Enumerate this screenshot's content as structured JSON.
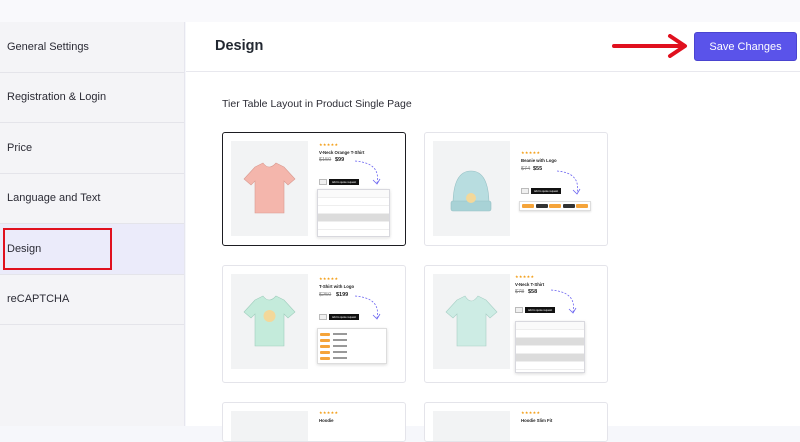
{
  "sidebar": {
    "items": [
      {
        "label": "General Settings"
      },
      {
        "label": "Registration & Login"
      },
      {
        "label": "Price"
      },
      {
        "label": "Language and Text"
      },
      {
        "label": "Design",
        "active": true
      },
      {
        "label": "reCAPTCHA"
      }
    ]
  },
  "header": {
    "title": "Design",
    "save_label": "Save Changes"
  },
  "section": {
    "title": "Tier Table Layout in Product Single Page"
  },
  "colors": {
    "accent": "#5a53ea",
    "annotation_red": "#e0101e"
  },
  "layouts": [
    {
      "product": "V-Neck Orange T-Shirt",
      "old_price": "$150",
      "new_price": "$99",
      "button": "Add to quote request",
      "style": "table",
      "selected": true,
      "tee_color": "#f4b6ac"
    },
    {
      "product": "Beanie with Logo",
      "old_price": "$74",
      "new_price": "$55",
      "button": "Add to quote request",
      "style": "chips",
      "selected": false,
      "tee_color": "#b8dde0"
    },
    {
      "product": "T-Shirt with Logo",
      "old_price": "$250",
      "new_price": "$199",
      "button": "Add to quote request",
      "style": "list",
      "selected": false,
      "tee_color": "#c4ebdb"
    },
    {
      "product": "V-Neck T-Shirt",
      "old_price": "$78",
      "new_price": "$58",
      "button": "Add to quote request",
      "style": "table",
      "selected": false,
      "tee_color": "#cdece4"
    },
    {
      "product": "Hoodie",
      "old_price": "",
      "new_price": "",
      "button": "",
      "style": "partial",
      "selected": false,
      "tee_color": "#f4b6ac"
    },
    {
      "product": "Hoodie Slim Fit",
      "old_price": "",
      "new_price": "",
      "button": "",
      "style": "partial",
      "selected": false,
      "tee_color": "#f4b6ac"
    }
  ],
  "stars": "★★★★★"
}
